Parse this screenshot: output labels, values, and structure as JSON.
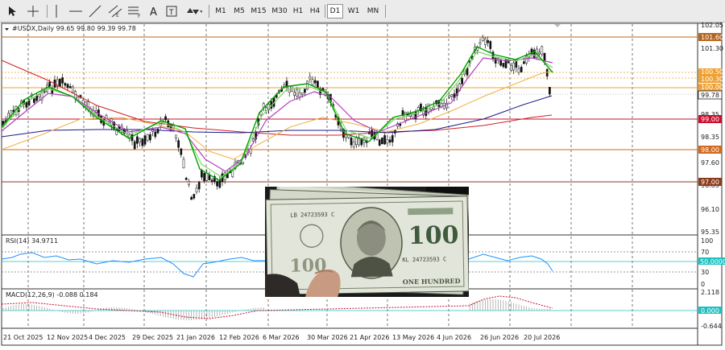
{
  "toolbar": {
    "tools": [
      "cursor-icon",
      "crosshair-icon",
      "vertical-line-icon",
      "horizontal-line-icon",
      "trendline-icon",
      "equidistant-channel-icon",
      "fibonacci-icon",
      "text-icon",
      "text-label-icon",
      "arrows-icon"
    ],
    "timeframes": [
      "M1",
      "M5",
      "M15",
      "M30",
      "H1",
      "H4",
      "D1",
      "W1",
      "MN"
    ],
    "active_timeframe": "D1"
  },
  "main": {
    "symbol_label": "#USDX,Daily  99.65 99.80 99.39 99.78",
    "price_axis": [
      "102.05",
      "101.30",
      "100.55",
      "99.78",
      "98.35",
      "97.60",
      "96.85",
      "96.10",
      "95.35"
    ],
    "levels": [
      {
        "value": "101.60",
        "color": "#b5651d"
      },
      {
        "value": "100.50",
        "color": "#f0a030"
      },
      {
        "value": "100.30",
        "color": "#f0a030"
      },
      {
        "value": "100.00",
        "color": "#f0a030"
      },
      {
        "value": "99.00",
        "color": "#c8102e"
      },
      {
        "value": "98.00",
        "color": "#d2691e"
      },
      {
        "value": "97.00",
        "color": "#8b3a1a"
      }
    ],
    "current_price": "99.78"
  },
  "rsi": {
    "label": "RSI(14) 34.9711",
    "axis": [
      "100",
      "70",
      "50.0000",
      "30",
      "0"
    ]
  },
  "macd": {
    "label": "MACD(12,26,9) -0.088 0.184",
    "axis": [
      "2.118",
      "0.000",
      "-0.644"
    ]
  },
  "dates": [
    "21 Oct 2025",
    "12 Nov 2025",
    "4 Dec 2025",
    "29 Dec 2025",
    "21 Jan 2026",
    "12 Feb 2026",
    "6 Mar 2026",
    "30 Mar 2026",
    "21 Apr 2026",
    "13 May 2026",
    "4 Jun 2026",
    "26 Jun 2026",
    "20 Jul 2026"
  ],
  "colors": {
    "ma_green": "#00a000",
    "ma_light_green": "#7fd36a",
    "ma_violet": "#b040c0",
    "ma_orange": "#f0b040",
    "ma_navy": "#1a1a8c",
    "ma_red": "#d02020",
    "rsi_line": "#1e90ff",
    "macd_signal": "#c8102e",
    "tag_teal": "#20c0c0"
  },
  "photo": {
    "banknote_top_serial": "LB 24723593 C",
    "banknote_bottom_serial": "KL 24723593 C",
    "denomination": "100",
    "text": "ONE HUNDRED"
  }
}
